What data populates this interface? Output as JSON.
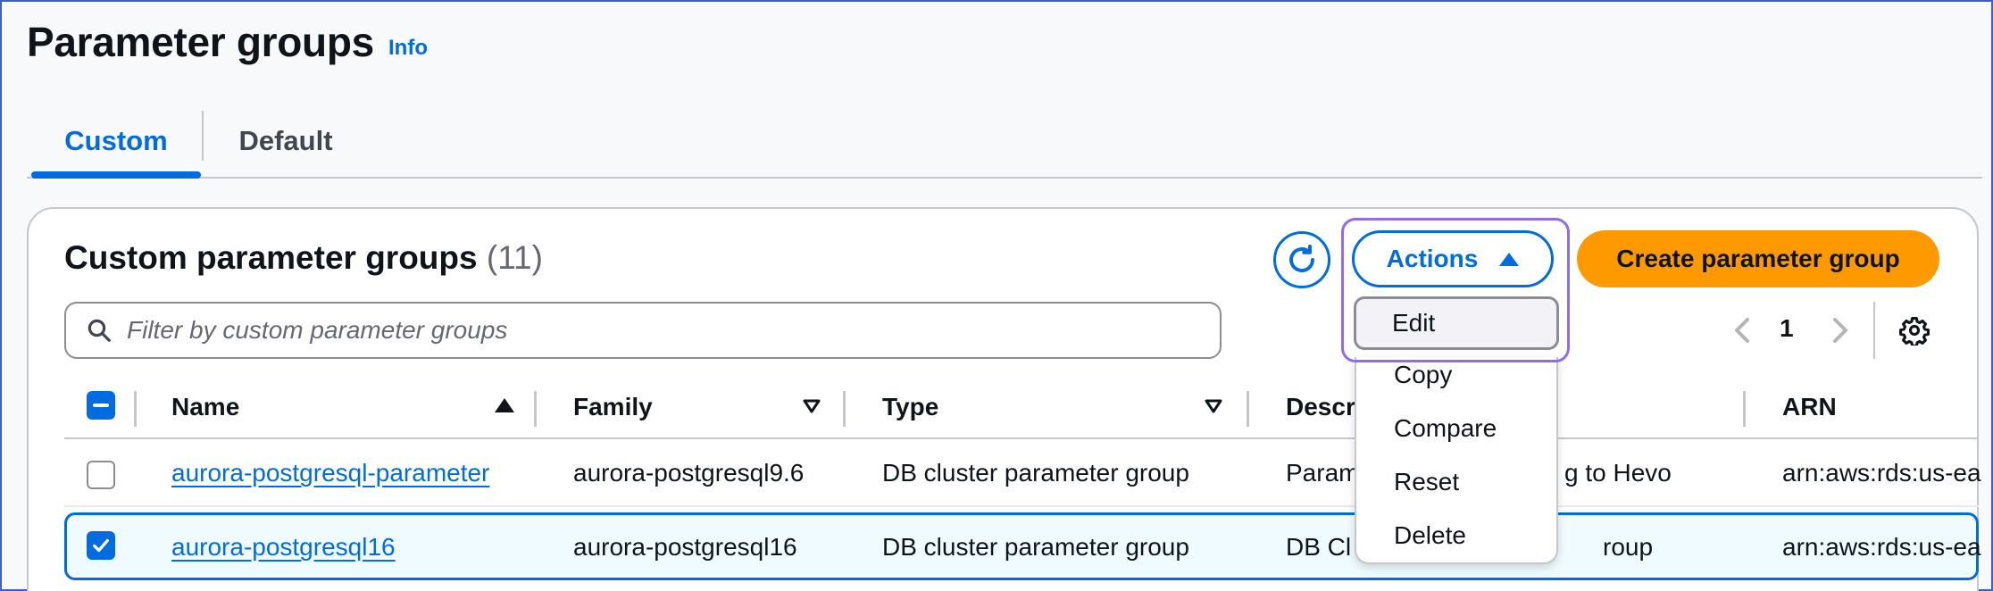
{
  "page": {
    "title": "Parameter groups",
    "info_link": "Info"
  },
  "tabs": [
    {
      "label": "Custom",
      "active": true
    },
    {
      "label": "Default",
      "active": false
    }
  ],
  "panel": {
    "title": "Custom parameter groups",
    "count": "(11)",
    "actions_label": "Actions",
    "create_label": "Create parameter group",
    "search_placeholder": "Filter by custom parameter groups",
    "page_number": "1"
  },
  "columns": [
    "Name",
    "Family",
    "Type",
    "Descr",
    "ARN"
  ],
  "rows": [
    {
      "name": "aurora-postgresql-parameter",
      "family": "aurora-postgresql9.6",
      "type": "DB cluster parameter group",
      "description_left": "Param",
      "description_right": "g to Hevo",
      "arn": "arn:aws:rds:us-ea",
      "selected": false
    },
    {
      "name": "aurora-postgresql16",
      "family": "aurora-postgresql16",
      "type": "DB cluster parameter group",
      "description_left": "DB Cl",
      "description_right": "roup",
      "arn": "arn:aws:rds:us-ea",
      "selected": true
    }
  ],
  "actions_menu": [
    "Edit",
    "Copy",
    "Compare",
    "Reset",
    "Delete"
  ],
  "colors": {
    "accent": "#006ce0",
    "primary_button": "#ff9900",
    "highlight": "#8f6cf0"
  }
}
